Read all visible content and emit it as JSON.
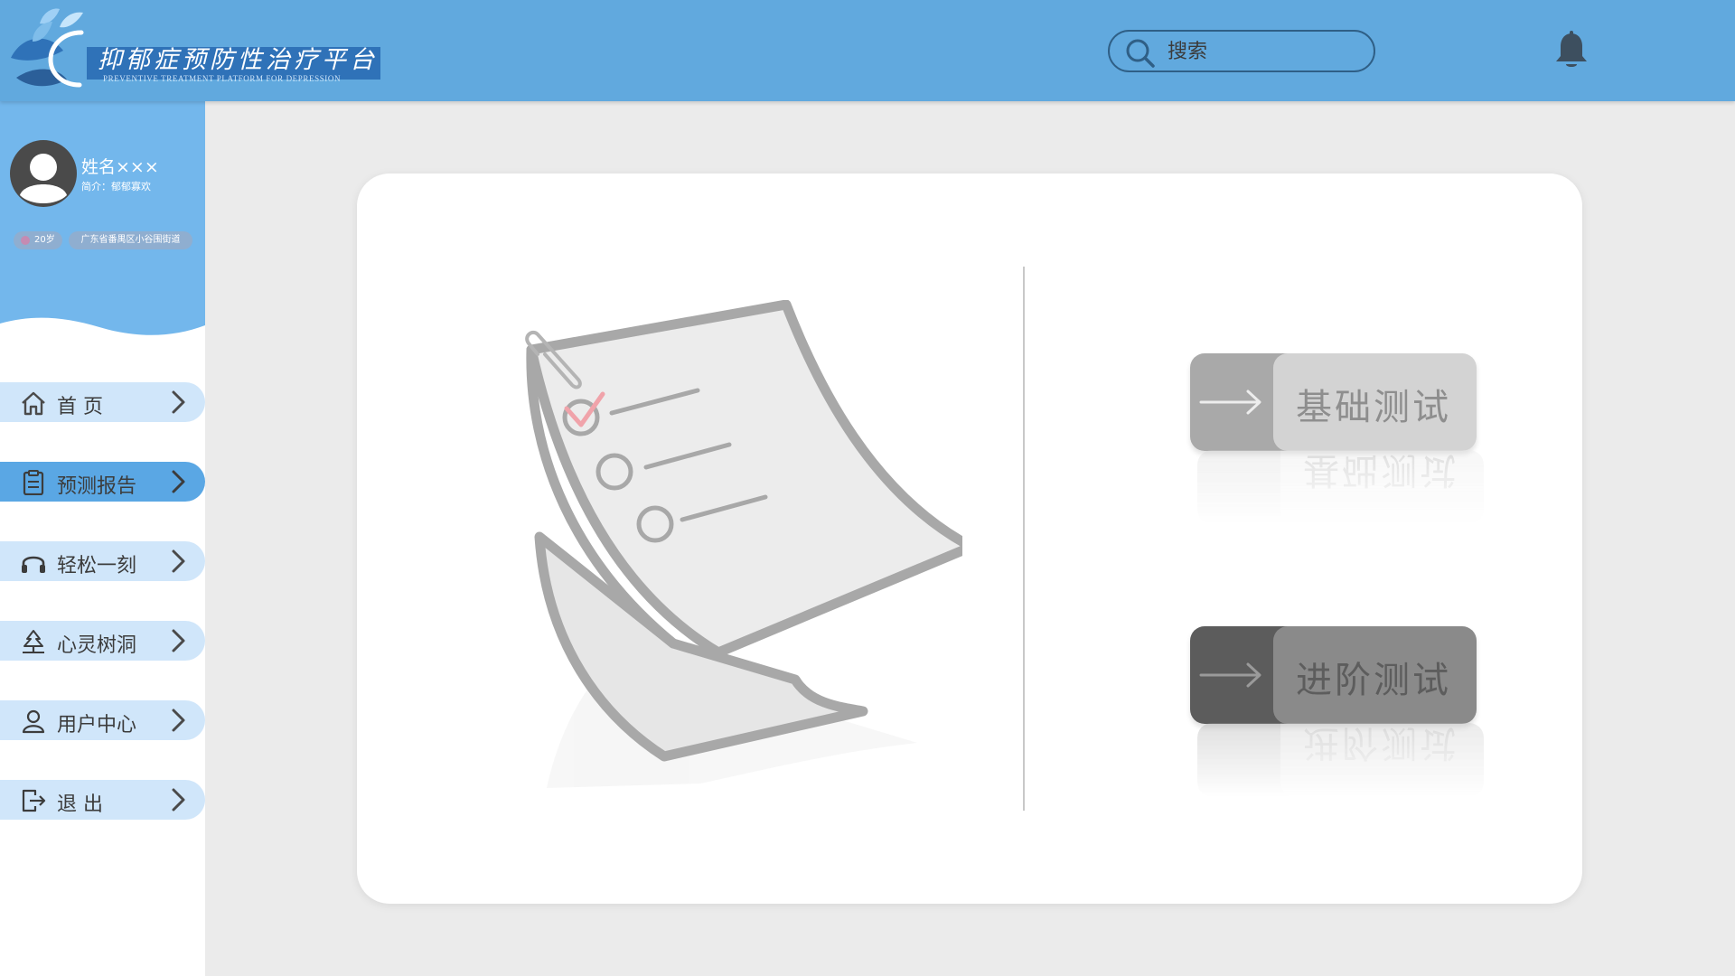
{
  "header": {
    "logo_title": "抑郁症预防性治疗平台",
    "logo_subtitle": "PREVENTIVE TREATMENT PLATFORM FOR DEPRESSION",
    "search_placeholder": "搜索",
    "bell_icon": "bell-icon"
  },
  "profile": {
    "name": "姓名×××",
    "intro": "简介：郁郁寡欢",
    "age": "20岁",
    "location": "广东省番禺区小谷围街道"
  },
  "sidebar": {
    "items": [
      {
        "label": "首 页",
        "icon": "home-icon",
        "active": false
      },
      {
        "label": "预测报告",
        "icon": "clipboard-icon",
        "active": true
      },
      {
        "label": "轻松一刻",
        "icon": "headphones-icon",
        "active": false
      },
      {
        "label": "心灵树洞",
        "icon": "tree-icon",
        "active": false
      },
      {
        "label": "用户中心",
        "icon": "user-icon",
        "active": false
      },
      {
        "label": "退 出",
        "icon": "logout-icon",
        "active": false
      }
    ]
  },
  "main": {
    "basic_test_label": "基础测试",
    "advanced_test_label": "进阶测试"
  },
  "colors": {
    "header_bg": "#61a9de",
    "nav_item_bg": "#d0e6fa",
    "nav_active_bg": "#5aa7e4",
    "page_bg": "#ebebeb"
  }
}
